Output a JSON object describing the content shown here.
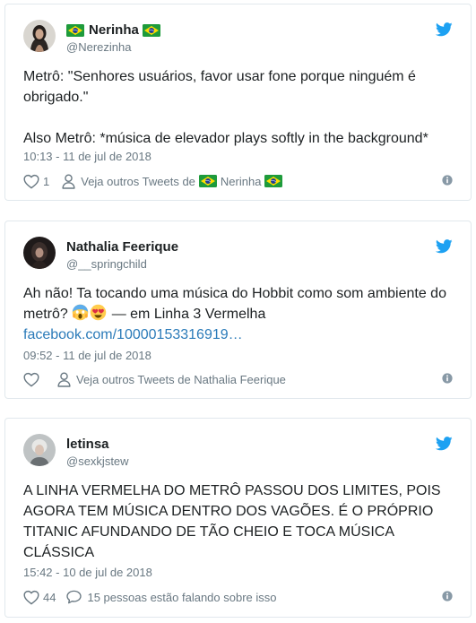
{
  "tweets": [
    {
      "author_name": "Nerinha",
      "handle": "@Nerezinha",
      "paragraph_1": "Metrô: \"Senhores usuários, favor usar fone porque ninguém é obrigado.\"",
      "paragraph_2": "Also Metrô: *música de elevador plays softly in the background*",
      "timestamp": "10:13 - 11 de jul de 2018",
      "likes": "1",
      "secondary_action": "Veja outros Tweets de",
      "secondary_action_name": "Nerinha"
    },
    {
      "author_name": "Nathalia Feerique",
      "handle": "@__springchild",
      "text": "Ah não! Ta tocando uma música do Hobbit como som ambiente do metrô?",
      "text_after_emoji": " — em Linha 3 Vermelha",
      "link": "facebook.com/10000153316919…",
      "timestamp": "09:52 - 11 de jul de 2018",
      "likes": "",
      "secondary_action": "Veja outros Tweets de Nathalia Feerique"
    },
    {
      "author_name": "letinsa",
      "handle": "@sexkjstew",
      "text": "A LINHA VERMELHA DO METRÔ PASSOU DOS LIMITES, POIS AGORA TEM MÚSICA DENTRO DOS VAGÕES. É O PRÓPRIO TITANIC AFUNDANDO DE TÃO CHEIO E TOCA MÚSICA CLÁSSICA",
      "timestamp": "15:42 - 10 de jul de 2018",
      "likes": "44",
      "secondary_action": "15 pessoas estão falando sobre isso"
    }
  ],
  "icons": {
    "brand": "twitter-bird-icon",
    "like": "heart-icon",
    "profile": "person-icon",
    "reply": "speech-bubble-icon",
    "info": "info-icon",
    "flag": "brazil-flag-icon",
    "emoji_1": "screaming-face-emoji",
    "emoji_2": "heart-eyes-emoji"
  },
  "colors": {
    "brand_blue": "#1da1f2",
    "link_blue": "#2b7bb9",
    "secondary_text": "#697882",
    "primary_text": "#1c2022",
    "border": "#e1e8ed"
  }
}
